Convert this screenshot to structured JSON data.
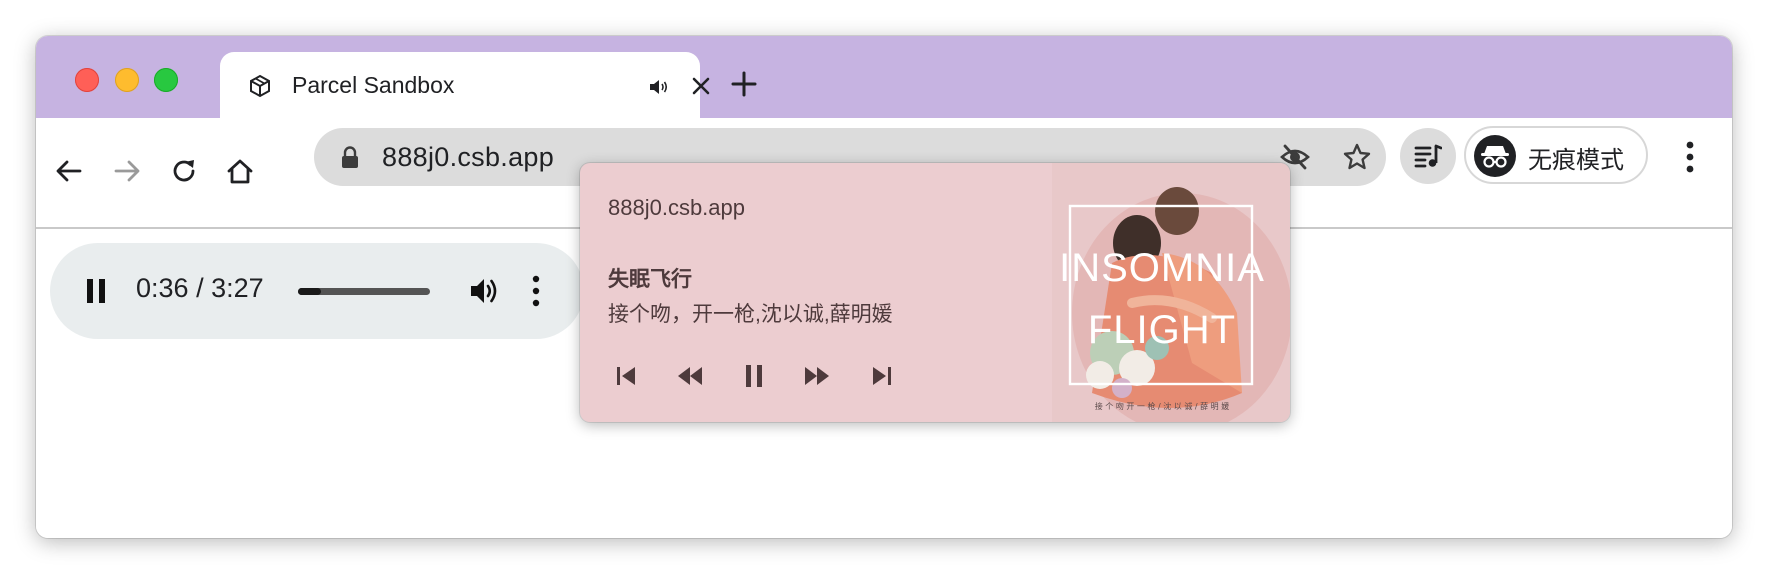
{
  "browser": {
    "tab": {
      "title": "Parcel Sandbox"
    },
    "address_bar": {
      "url": "888j0.csb.app"
    },
    "profile": {
      "label": "无痕模式"
    }
  },
  "audio_player": {
    "current_time": "0:36",
    "separator": "/",
    "duration": "3:27",
    "progress_fraction": 0.174
  },
  "media_popup": {
    "origin": "888j0.csb.app",
    "track_title": "失眠飞行",
    "artists": "接个吻，开一枪,沈以诚,薛明媛",
    "artwork_text": {
      "line1": "INSOMNIA",
      "line2": "FLIGHT",
      "credit": "接 个 吻 开 一 枪 / 沈 以 诚 / 薛 明 媛"
    }
  },
  "colors": {
    "titlebar": "#c6b3e1",
    "popup_bg": "#eccdd0",
    "player_bg": "#e9edee"
  },
  "icons": [
    "codesandbox-icon",
    "speaker-icon",
    "close-icon",
    "plus-icon",
    "back-arrow-icon",
    "forward-arrow-icon",
    "reload-icon",
    "home-icon",
    "lock-icon",
    "eye-off-icon",
    "star-icon",
    "media-queue-icon",
    "incognito-icon",
    "more-vertical-icon",
    "pause-icon",
    "volume-icon",
    "skip-previous-icon",
    "rewind-icon",
    "fast-forward-icon",
    "skip-next-icon"
  ]
}
